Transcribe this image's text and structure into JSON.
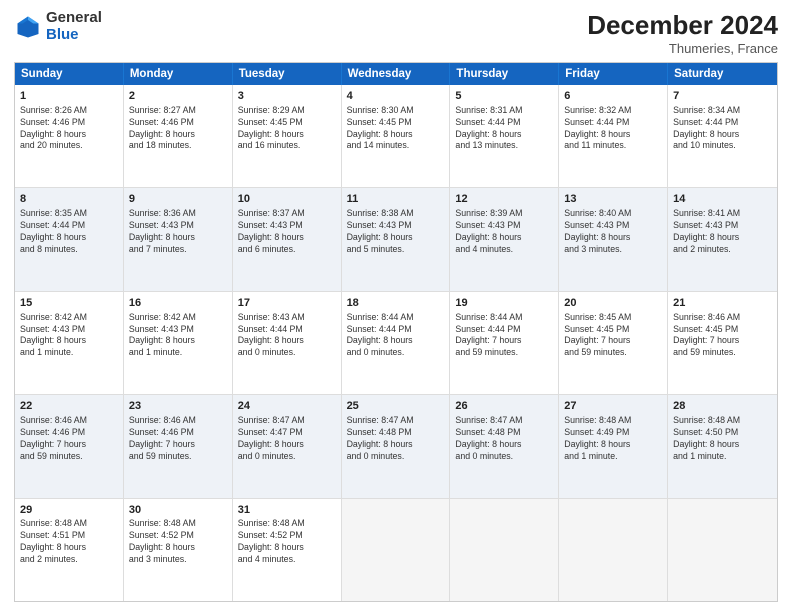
{
  "header": {
    "logo_general": "General",
    "logo_blue": "Blue",
    "month_year": "December 2024",
    "location": "Thumeries, France"
  },
  "weekdays": [
    "Sunday",
    "Monday",
    "Tuesday",
    "Wednesday",
    "Thursday",
    "Friday",
    "Saturday"
  ],
  "rows": [
    {
      "alt": false,
      "cells": [
        {
          "day": "1",
          "lines": [
            "Sunrise: 8:26 AM",
            "Sunset: 4:46 PM",
            "Daylight: 8 hours",
            "and 20 minutes."
          ]
        },
        {
          "day": "2",
          "lines": [
            "Sunrise: 8:27 AM",
            "Sunset: 4:46 PM",
            "Daylight: 8 hours",
            "and 18 minutes."
          ]
        },
        {
          "day": "3",
          "lines": [
            "Sunrise: 8:29 AM",
            "Sunset: 4:45 PM",
            "Daylight: 8 hours",
            "and 16 minutes."
          ]
        },
        {
          "day": "4",
          "lines": [
            "Sunrise: 8:30 AM",
            "Sunset: 4:45 PM",
            "Daylight: 8 hours",
            "and 14 minutes."
          ]
        },
        {
          "day": "5",
          "lines": [
            "Sunrise: 8:31 AM",
            "Sunset: 4:44 PM",
            "Daylight: 8 hours",
            "and 13 minutes."
          ]
        },
        {
          "day": "6",
          "lines": [
            "Sunrise: 8:32 AM",
            "Sunset: 4:44 PM",
            "Daylight: 8 hours",
            "and 11 minutes."
          ]
        },
        {
          "day": "7",
          "lines": [
            "Sunrise: 8:34 AM",
            "Sunset: 4:44 PM",
            "Daylight: 8 hours",
            "and 10 minutes."
          ]
        }
      ]
    },
    {
      "alt": true,
      "cells": [
        {
          "day": "8",
          "lines": [
            "Sunrise: 8:35 AM",
            "Sunset: 4:44 PM",
            "Daylight: 8 hours",
            "and 8 minutes."
          ]
        },
        {
          "day": "9",
          "lines": [
            "Sunrise: 8:36 AM",
            "Sunset: 4:43 PM",
            "Daylight: 8 hours",
            "and 7 minutes."
          ]
        },
        {
          "day": "10",
          "lines": [
            "Sunrise: 8:37 AM",
            "Sunset: 4:43 PM",
            "Daylight: 8 hours",
            "and 6 minutes."
          ]
        },
        {
          "day": "11",
          "lines": [
            "Sunrise: 8:38 AM",
            "Sunset: 4:43 PM",
            "Daylight: 8 hours",
            "and 5 minutes."
          ]
        },
        {
          "day": "12",
          "lines": [
            "Sunrise: 8:39 AM",
            "Sunset: 4:43 PM",
            "Daylight: 8 hours",
            "and 4 minutes."
          ]
        },
        {
          "day": "13",
          "lines": [
            "Sunrise: 8:40 AM",
            "Sunset: 4:43 PM",
            "Daylight: 8 hours",
            "and 3 minutes."
          ]
        },
        {
          "day": "14",
          "lines": [
            "Sunrise: 8:41 AM",
            "Sunset: 4:43 PM",
            "Daylight: 8 hours",
            "and 2 minutes."
          ]
        }
      ]
    },
    {
      "alt": false,
      "cells": [
        {
          "day": "15",
          "lines": [
            "Sunrise: 8:42 AM",
            "Sunset: 4:43 PM",
            "Daylight: 8 hours",
            "and 1 minute."
          ]
        },
        {
          "day": "16",
          "lines": [
            "Sunrise: 8:42 AM",
            "Sunset: 4:43 PM",
            "Daylight: 8 hours",
            "and 1 minute."
          ]
        },
        {
          "day": "17",
          "lines": [
            "Sunrise: 8:43 AM",
            "Sunset: 4:44 PM",
            "Daylight: 8 hours",
            "and 0 minutes."
          ]
        },
        {
          "day": "18",
          "lines": [
            "Sunrise: 8:44 AM",
            "Sunset: 4:44 PM",
            "Daylight: 8 hours",
            "and 0 minutes."
          ]
        },
        {
          "day": "19",
          "lines": [
            "Sunrise: 8:44 AM",
            "Sunset: 4:44 PM",
            "Daylight: 7 hours",
            "and 59 minutes."
          ]
        },
        {
          "day": "20",
          "lines": [
            "Sunrise: 8:45 AM",
            "Sunset: 4:45 PM",
            "Daylight: 7 hours",
            "and 59 minutes."
          ]
        },
        {
          "day": "21",
          "lines": [
            "Sunrise: 8:46 AM",
            "Sunset: 4:45 PM",
            "Daylight: 7 hours",
            "and 59 minutes."
          ]
        }
      ]
    },
    {
      "alt": true,
      "cells": [
        {
          "day": "22",
          "lines": [
            "Sunrise: 8:46 AM",
            "Sunset: 4:46 PM",
            "Daylight: 7 hours",
            "and 59 minutes."
          ]
        },
        {
          "day": "23",
          "lines": [
            "Sunrise: 8:46 AM",
            "Sunset: 4:46 PM",
            "Daylight: 7 hours",
            "and 59 minutes."
          ]
        },
        {
          "day": "24",
          "lines": [
            "Sunrise: 8:47 AM",
            "Sunset: 4:47 PM",
            "Daylight: 8 hours",
            "and 0 minutes."
          ]
        },
        {
          "day": "25",
          "lines": [
            "Sunrise: 8:47 AM",
            "Sunset: 4:48 PM",
            "Daylight: 8 hours",
            "and 0 minutes."
          ]
        },
        {
          "day": "26",
          "lines": [
            "Sunrise: 8:47 AM",
            "Sunset: 4:48 PM",
            "Daylight: 8 hours",
            "and 0 minutes."
          ]
        },
        {
          "day": "27",
          "lines": [
            "Sunrise: 8:48 AM",
            "Sunset: 4:49 PM",
            "Daylight: 8 hours",
            "and 1 minute."
          ]
        },
        {
          "day": "28",
          "lines": [
            "Sunrise: 8:48 AM",
            "Sunset: 4:50 PM",
            "Daylight: 8 hours",
            "and 1 minute."
          ]
        }
      ]
    },
    {
      "alt": false,
      "cells": [
        {
          "day": "29",
          "lines": [
            "Sunrise: 8:48 AM",
            "Sunset: 4:51 PM",
            "Daylight: 8 hours",
            "and 2 minutes."
          ]
        },
        {
          "day": "30",
          "lines": [
            "Sunrise: 8:48 AM",
            "Sunset: 4:52 PM",
            "Daylight: 8 hours",
            "and 3 minutes."
          ]
        },
        {
          "day": "31",
          "lines": [
            "Sunrise: 8:48 AM",
            "Sunset: 4:52 PM",
            "Daylight: 8 hours",
            "and 4 minutes."
          ]
        },
        {
          "day": "",
          "lines": []
        },
        {
          "day": "",
          "lines": []
        },
        {
          "day": "",
          "lines": []
        },
        {
          "day": "",
          "lines": []
        }
      ]
    }
  ]
}
